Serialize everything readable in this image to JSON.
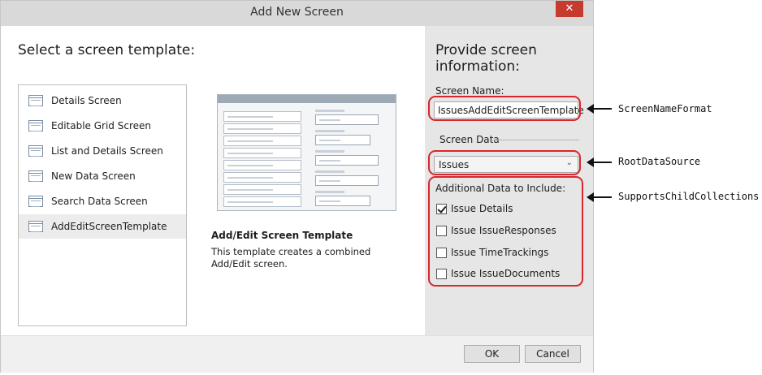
{
  "window": {
    "title": "Add New Screen",
    "close_glyph": "✕"
  },
  "left": {
    "heading": "Select a screen template:",
    "templates": [
      {
        "label": "Details Screen",
        "selected": false
      },
      {
        "label": "Editable Grid Screen",
        "selected": false
      },
      {
        "label": "List and Details Screen",
        "selected": false
      },
      {
        "label": "New Data Screen",
        "selected": false
      },
      {
        "label": "Search Data Screen",
        "selected": false
      },
      {
        "label": "AddEditScreenTemplate",
        "selected": true
      }
    ],
    "template_title": "Add/Edit Screen Template",
    "template_description": "This template creates a combined Add/Edit screen."
  },
  "right": {
    "heading_line1": "Provide screen",
    "heading_line2": "information:",
    "screen_name_label": "Screen Name:",
    "screen_name_value": "IssuesAddEditScreenTemplate",
    "screen_data_label": "Screen Data",
    "screen_data_value": "Issues",
    "additional_label": "Additional Data to Include:",
    "checkboxes": [
      {
        "label": "Issue Details",
        "checked": true
      },
      {
        "label": "Issue IssueResponses",
        "checked": false
      },
      {
        "label": "Issue TimeTrackings",
        "checked": false
      },
      {
        "label": "Issue IssueDocuments",
        "checked": false
      }
    ]
  },
  "footer": {
    "ok_label": "OK",
    "cancel_label": "Cancel"
  },
  "annotations": {
    "screen_name": "ScreenNameFormat",
    "root_data": "RootDataSource",
    "child": "SupportsChildCollections",
    "callout_color": "#d9262b"
  }
}
